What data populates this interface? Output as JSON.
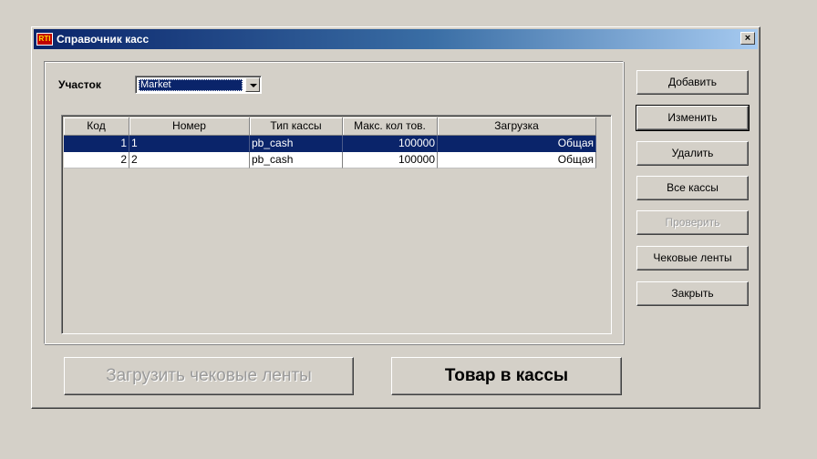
{
  "window": {
    "title": "Справочник касс",
    "icon_text": "RTI",
    "close_label": "×"
  },
  "filter": {
    "label": "Участок",
    "selected": "Market"
  },
  "table": {
    "columns": [
      "Код",
      "Номер",
      "Тип кассы",
      "Макс. кол тов.",
      "Загрузка"
    ],
    "rows": [
      {
        "kod": "1",
        "nomer": "1",
        "tip": "pb_cash",
        "maks": "100000",
        "zagruzka": "Общая"
      },
      {
        "kod": "2",
        "nomer": "2",
        "tip": "pb_cash",
        "maks": "100000",
        "zagruzka": "Общая"
      }
    ],
    "selected_row": 0
  },
  "buttons": {
    "add": "Добавить",
    "edit": "Изменить",
    "delete": "Удалить",
    "all": "Все кассы",
    "check": "Проверить",
    "receipts": "Чековые ленты",
    "close": "Закрыть",
    "load_receipts": "Загрузить чековые ленты",
    "goods_to_cash": "Товар в кассы"
  },
  "colors": {
    "selection": "#0a246a",
    "face": "#d4d0c8",
    "disabled_text": "#9a9a9a"
  }
}
